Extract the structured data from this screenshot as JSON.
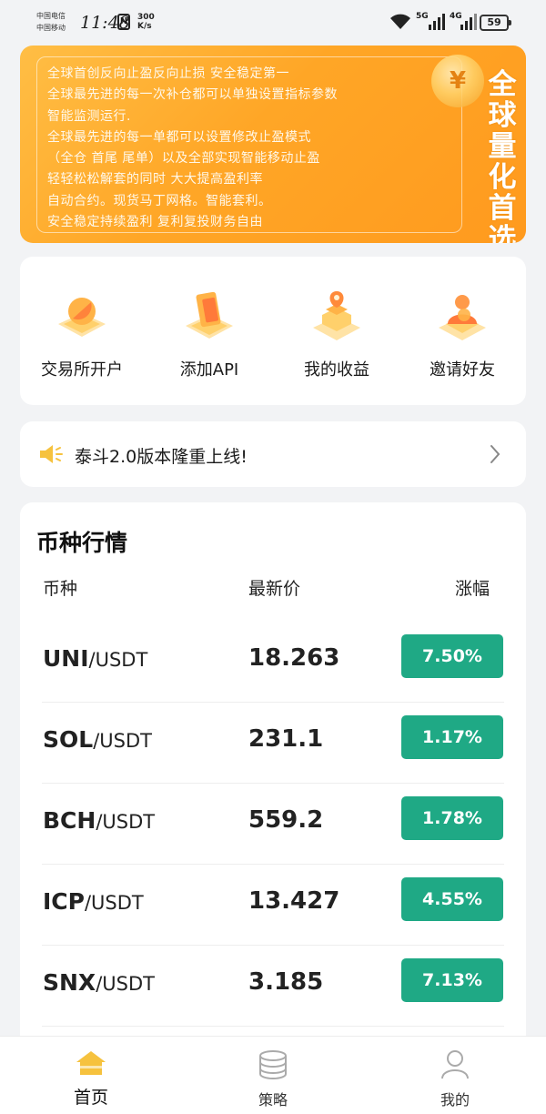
{
  "status_bar": {
    "carrier_1": "中国电信",
    "carrier_2": "中国移动",
    "time": "11:48",
    "nfc": "N",
    "net_speed_value": "300",
    "net_speed_unit": "K/s",
    "sim1_type": "5G",
    "sim2_type": "4G",
    "battery": "59"
  },
  "banner": {
    "lines": [
      "全球首创反向止盈反向止损 安全稳定第一",
      "全球最先进的每一次补仓都可以单独设置指标参数",
      "智能监测运行.",
      "全球最先进的每一单都可以设置修改止盈模式",
      "（全仓 首尾 尾单）以及全部实现智能移动止盈",
      " 轻轻松松解套的同时 大大提高盈利率",
      "自动合约。现货马丁网格。智能套利。",
      "安全稳定持续盈利 复利复投财务自由"
    ],
    "coin_symbol": "¥",
    "slogan": [
      "全",
      "球",
      "量",
      "化",
      "首",
      "选"
    ]
  },
  "actions": [
    {
      "label": "交易所开户",
      "icon": "exchange-account-icon"
    },
    {
      "label": "添加API",
      "icon": "add-api-icon"
    },
    {
      "label": "我的收益",
      "icon": "my-earnings-icon"
    },
    {
      "label": "邀请好友",
      "icon": "invite-friends-icon"
    }
  ],
  "notice": {
    "text": "泰斗2.0版本隆重上线!",
    "icon": "speaker-icon"
  },
  "market": {
    "title": "币种行情",
    "columns": {
      "symbol": "币种",
      "price": "最新价",
      "change": "涨幅"
    },
    "rows": [
      {
        "base": "UNI",
        "quote": "/USDT",
        "price": "18.263",
        "change": "7.50%"
      },
      {
        "base": "SOL",
        "quote": "/USDT",
        "price": "231.1",
        "change": "1.17%"
      },
      {
        "base": "BCH",
        "quote": "/USDT",
        "price": "559.2",
        "change": "1.78%"
      },
      {
        "base": "ICP",
        "quote": "/USDT",
        "price": "13.427",
        "change": "4.55%"
      },
      {
        "base": "SNX",
        "quote": "/USDT",
        "price": "3.185",
        "change": "7.13%"
      }
    ],
    "up_color": "#1fa985"
  },
  "tabbar": {
    "tabs": [
      {
        "label": "首页",
        "icon": "home-icon",
        "active": true
      },
      {
        "label": "策略",
        "icon": "database-icon",
        "active": false
      },
      {
        "label": "我的",
        "icon": "user-icon",
        "active": false
      }
    ]
  },
  "colors": {
    "accent": "#ffa626",
    "tab_active": "#f6c23e"
  }
}
